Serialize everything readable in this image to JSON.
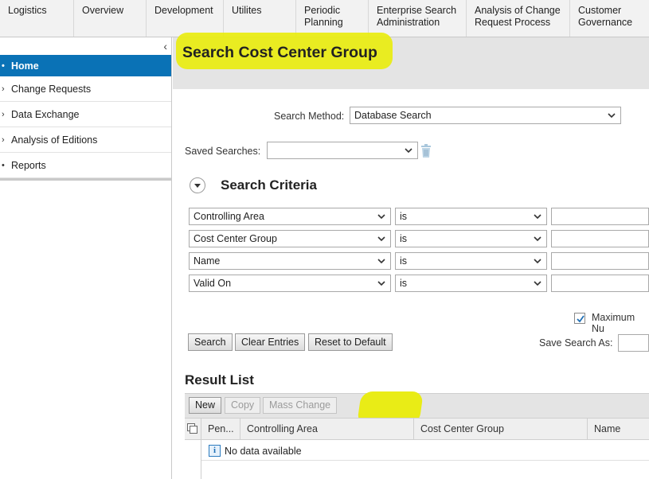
{
  "top_nav": {
    "tabs": [
      {
        "label": "Logistics"
      },
      {
        "label": "Overview"
      },
      {
        "label": "Development"
      },
      {
        "label": "Utilites"
      },
      {
        "label": "Periodic\nPlanning"
      },
      {
        "label": "Enterprise Search\nAdministration"
      },
      {
        "label": "Analysis of Change\nRequest Process"
      },
      {
        "label": "Customer\nGovernance"
      }
    ]
  },
  "sidebar": {
    "items": [
      {
        "label": "Home",
        "icon": "bullet-icon",
        "active": true
      },
      {
        "label": "Change Requests",
        "icon": "chevron-right-icon"
      },
      {
        "label": "Data Exchange",
        "icon": "chevron-right-icon"
      },
      {
        "label": "Analysis of Editions",
        "icon": "chevron-right-icon"
      },
      {
        "label": "Reports",
        "icon": "bullet-icon"
      }
    ]
  },
  "header": {
    "title": "Search Cost Center Group"
  },
  "search": {
    "method_label": "Search Method:",
    "method_value": "Database Search",
    "saved_label": "Saved Searches:",
    "saved_value": ""
  },
  "criteria": {
    "title": "Search Criteria",
    "rows": [
      {
        "field": "Controlling Area",
        "operator": "is",
        "value": ""
      },
      {
        "field": "Cost Center Group",
        "operator": "is",
        "value": ""
      },
      {
        "field": "Name",
        "operator": "is",
        "value": ""
      },
      {
        "field": "Valid On",
        "operator": "is",
        "value": ""
      }
    ],
    "max_number_label": "Maximum Nu",
    "max_number_checked": true
  },
  "actions": {
    "search": "Search",
    "clear": "Clear Entries",
    "reset": "Reset to Default",
    "save_search_label": "Save Search As:"
  },
  "results": {
    "title": "Result List",
    "toolbar": {
      "new": "New",
      "copy": "Copy",
      "mass_change": "Mass Change"
    },
    "columns": [
      "Pen...",
      "Controlling Area",
      "Cost Center Group",
      "Name"
    ],
    "empty_message": "No data available"
  },
  "colors": {
    "accent": "#0a72b6",
    "highlight": "#e9ec16"
  }
}
